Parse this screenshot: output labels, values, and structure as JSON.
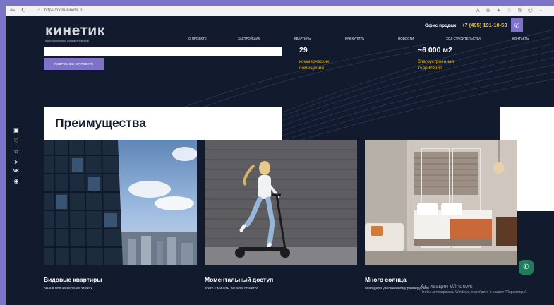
{
  "browser": {
    "back_icon": "arrow-left-icon",
    "refresh_icon": "refresh-icon",
    "url": "https://dom-kinetik.ru",
    "tool_icons": [
      "read-aloud-icon",
      "zoom-icon",
      "extension-icon",
      "favorites-icon",
      "collections-icon",
      "account-icon",
      "settings-icon"
    ]
  },
  "header": {
    "logo_name": "кинетик",
    "logo_sub": "жилой комплекс на Дмитровском",
    "office_label": "Офис продаж",
    "phone": "+7 (495) 191-10-53",
    "call_icon": "phone-icon"
  },
  "nav": {
    "items": [
      "О ПРОЕКТЕ",
      "ЗАСТРОЙЩИК",
      "КВАРТИРЫ",
      "КАК КУПИТЬ",
      "НОВОСТИ",
      "ХОД СТРОИТЕЛЬСТВА",
      "КОНТАКТЫ"
    ]
  },
  "hero": {
    "more_button": "ПОДРОБНЕЕ О ПРОЕКТЕ",
    "stats": [
      {
        "num": "29",
        "label": "коммерческих помещений"
      },
      {
        "num": "~6 000 м2",
        "label": "благоустроенная территория"
      }
    ]
  },
  "advantages": {
    "title": "Преимущества",
    "cards": [
      {
        "title": "Видовые квартиры",
        "subtitle": "окна в пол на верхних этажах"
      },
      {
        "title": "Моментальный доступ",
        "subtitle": "всего 2 минуты пешком от метро"
      },
      {
        "title": "Много солнца",
        "subtitle": "благодаря увеличенному размеру окон"
      }
    ]
  },
  "social_icons": [
    "gallery-icon",
    "heart-icon",
    "star-icon",
    "telegram-icon",
    "vk-icon",
    "whatsapp-icon"
  ],
  "vk_label": "VK",
  "chat_icon": "chat-phone-icon",
  "windows": {
    "line1": "Активация Windows",
    "line2": "Чтобы активировать Windows, перейдите в раздел \"Параметры\"."
  },
  "colors": {
    "page_bg": "#121a2d",
    "accent": "#7f73c7",
    "stat_label": "#f0b400",
    "phone": "#f2c21a"
  }
}
